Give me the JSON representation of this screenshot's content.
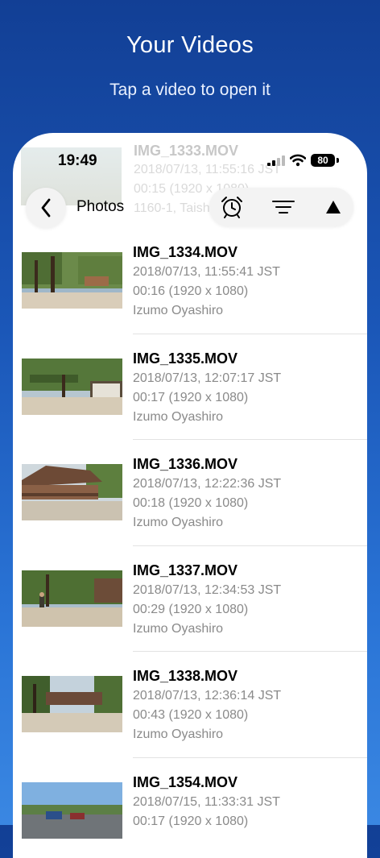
{
  "promo": {
    "title": "Your Videos",
    "subtitle": "Tap a video to open it"
  },
  "status_bar": {
    "time": "19:49",
    "battery": "80"
  },
  "background_row": {
    "filename": "IMG_1333.MOV",
    "date": "2018/07/13, 11:55:16 JST",
    "details": "00:15 (1920 x 1080)",
    "location": "1160-1, Taisha"
  },
  "nav": {
    "back_icon": "chevron-left-icon",
    "title": "Photos",
    "tools": [
      "alarm-clock-icon",
      "filter-lines-icon",
      "triangle-up-icon"
    ]
  },
  "videos": [
    {
      "filename": "IMG_1334.MOV",
      "date": "2018/07/13, 11:55:41 JST",
      "details": "00:16 (1920 x 1080)",
      "location": "Izumo Oyashiro"
    },
    {
      "filename": "IMG_1335.MOV",
      "date": "2018/07/13, 12:07:17 JST",
      "details": "00:17 (1920 x 1080)",
      "location": "Izumo Oyashiro"
    },
    {
      "filename": "IMG_1336.MOV",
      "date": "2018/07/13, 12:22:36 JST",
      "details": "00:18 (1920 x 1080)",
      "location": "Izumo Oyashiro"
    },
    {
      "filename": "IMG_1337.MOV",
      "date": "2018/07/13, 12:34:53 JST",
      "details": "00:29 (1920 x 1080)",
      "location": "Izumo Oyashiro"
    },
    {
      "filename": "IMG_1338.MOV",
      "date": "2018/07/13, 12:36:14 JST",
      "details": "00:43 (1920 x 1080)",
      "location": "Izumo Oyashiro"
    },
    {
      "filename": "IMG_1354.MOV",
      "date": "2018/07/15, 11:33:31 JST",
      "details": "00:17 (1920 x 1080)",
      "location": ""
    }
  ]
}
